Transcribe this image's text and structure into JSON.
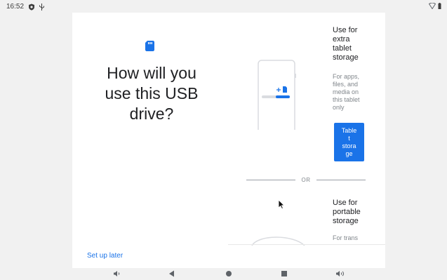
{
  "status_bar": {
    "time": "16:52"
  },
  "dialog": {
    "question": "How will you\nuse this USB\ndrive?",
    "setup_later": "Set up later",
    "option_internal": {
      "title": "Use for\nextra\ntablet\nstorage",
      "description": "For apps,\nfiles, and\nmedia on\nthis tablet\nonly",
      "button": "Table\nt\nstora\nge"
    },
    "or_label": "OR",
    "option_portable": {
      "title": "Use for\nportable\nstorage",
      "description": "For trans"
    }
  },
  "colors": {
    "accent": "#1a73e8",
    "text_primary": "#202124",
    "text_secondary": "#80868b",
    "background": "#f1f1f1",
    "dialog": "#ffffff"
  },
  "icons": {
    "status_left": [
      "shield-icon",
      "usb-icon"
    ],
    "status_right": [
      "wifi-icon",
      "battery-icon"
    ],
    "nav": [
      "volume-down-icon",
      "back-icon",
      "home-icon",
      "recents-icon",
      "volume-up-icon"
    ]
  }
}
